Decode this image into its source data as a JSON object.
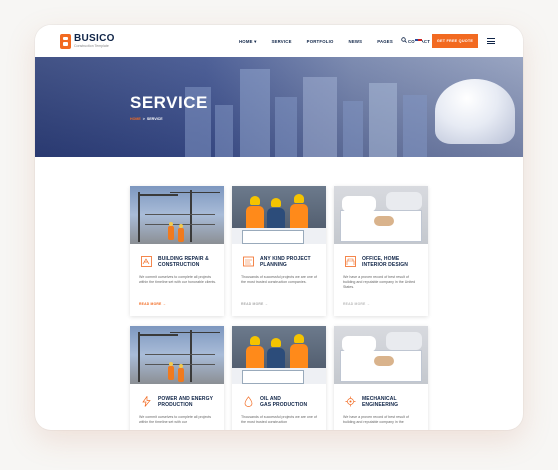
{
  "header": {
    "brand": "BUSICO",
    "tagline": "Construction Template",
    "nav": [
      "HOME ▾",
      "SERVICE",
      "PORTFOLIO",
      "NEWS",
      "PAGES",
      "CONTACT"
    ],
    "cta_label": "GET FREE QUOTE"
  },
  "hero": {
    "title": "SERVICE",
    "breadcrumb_home": "HOME",
    "breadcrumb_sep": ">",
    "breadcrumb_current": "SERVICE"
  },
  "services": [
    {
      "title_l1": "BUILDING REPAIR &",
      "title_l2": "CONSTRUCTION",
      "desc": "We commit ourselves to complete all projects within the timeline set with our honorable clients.",
      "link": "READ MORE →",
      "icon": "blueprint-icon"
    },
    {
      "title_l1": "ANY KIND PROJECT",
      "title_l2": "PLANNING",
      "desc": "Thousands of successful projects we are one of the most trusted construction companies.",
      "link": "READ MORE →",
      "icon": "planning-icon"
    },
    {
      "title_l1": "OFFICE, HOME",
      "title_l2": "INTERIOR DESIGN",
      "desc": "We have a proven record of best result of building and reputable company in the United States.",
      "link": "READ MORE →",
      "icon": "interior-icon"
    },
    {
      "title_l1": "POWER AND ENERGY",
      "title_l2": "PRODUCTION",
      "desc": "We commit ourselves to complete all projects within the timeline set with our",
      "link": "",
      "icon": "power-icon"
    },
    {
      "title_l1": "OIL AND",
      "title_l2": "GAS PRODUCTION",
      "desc": "Thousands of successful projects we are one of the most trusted construction",
      "link": "",
      "icon": "oil-gas-icon"
    },
    {
      "title_l1": "MECHANICAL",
      "title_l2": "ENGINEERING",
      "desc": "We have a proven record of best result of building and reputable company in the",
      "link": "",
      "icon": "engineering-icon"
    }
  ],
  "colors": {
    "accent": "#f26a21",
    "navy": "#0f2447",
    "hero": "#3b4f8c"
  }
}
